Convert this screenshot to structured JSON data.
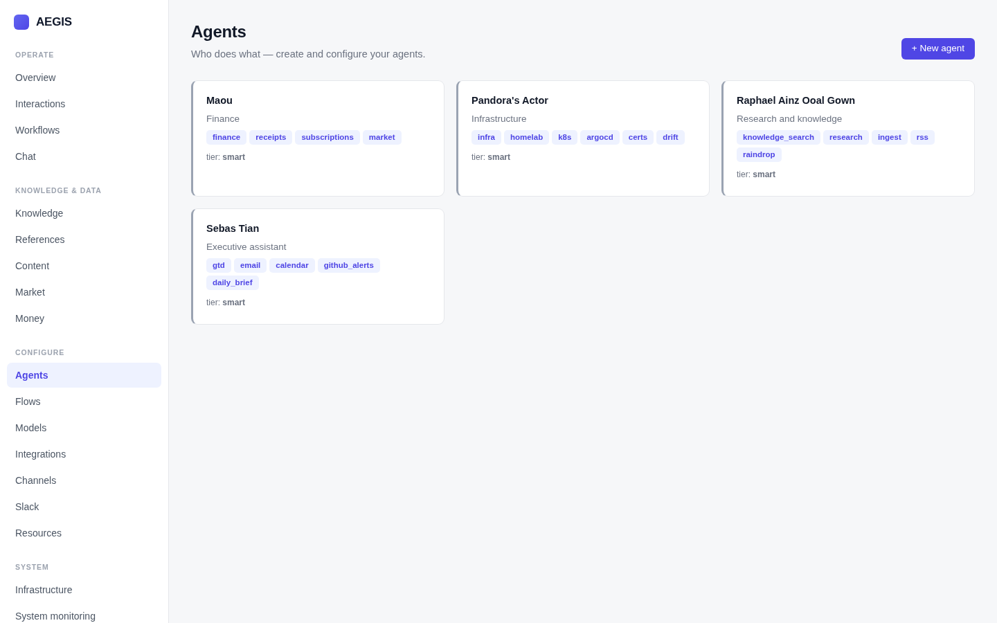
{
  "sidebar": {
    "brand": "AEGIS",
    "sections": [
      {
        "title": "OPERATE",
        "items": [
          {
            "label": "Overview",
            "selected": false
          },
          {
            "label": "Interactions",
            "selected": false
          },
          {
            "label": "Workflows",
            "selected": false
          },
          {
            "label": "Chat",
            "selected": false
          }
        ]
      },
      {
        "title": "KNOWLEDGE & DATA",
        "items": [
          {
            "label": "Knowledge",
            "selected": false
          },
          {
            "label": "References",
            "selected": false
          },
          {
            "label": "Content",
            "selected": false
          },
          {
            "label": "Market",
            "selected": false
          },
          {
            "label": "Money",
            "selected": false
          }
        ]
      },
      {
        "title": "CONFIGURE",
        "items": [
          {
            "label": "Agents",
            "selected": true
          },
          {
            "label": "Flows",
            "selected": false
          },
          {
            "label": "Models",
            "selected": false
          },
          {
            "label": "Integrations",
            "selected": false
          },
          {
            "label": "Channels",
            "selected": false
          },
          {
            "label": "Slack",
            "selected": false
          },
          {
            "label": "Resources",
            "selected": false
          }
        ]
      },
      {
        "title": "SYSTEM",
        "items": [
          {
            "label": "Infrastructure",
            "selected": false
          },
          {
            "label": "System monitoring",
            "selected": false
          }
        ]
      }
    ]
  },
  "header": {
    "title": "Agents",
    "subtitle": "Who does what — create and configure your agents.",
    "new_button": "+ New agent"
  },
  "agents": [
    {
      "name": "Maou",
      "role": "Finance",
      "tags": [
        "finance",
        "receipts",
        "subscriptions",
        "market"
      ],
      "tier": "tier: **smart**"
    },
    {
      "name": "Pandora's Actor",
      "role": "Infrastructure",
      "tags": [
        "infra",
        "homelab",
        "k8s",
        "argocd",
        "certs",
        "drift"
      ],
      "tier": "tier: **smart**"
    },
    {
      "name": "Raphael Ainz Ooal Gown",
      "role": "Research and knowledge",
      "tags": [
        "knowledge_search",
        "research",
        "ingest",
        "rss",
        "raindrop"
      ],
      "tier": "tier: **smart**"
    },
    {
      "name": "Sebas Tian",
      "role": "Executive assistant",
      "tags": [
        "gtd",
        "email",
        "calendar",
        "github_alerts",
        "daily_brief"
      ],
      "tier": "tier: **smart**"
    }
  ]
}
